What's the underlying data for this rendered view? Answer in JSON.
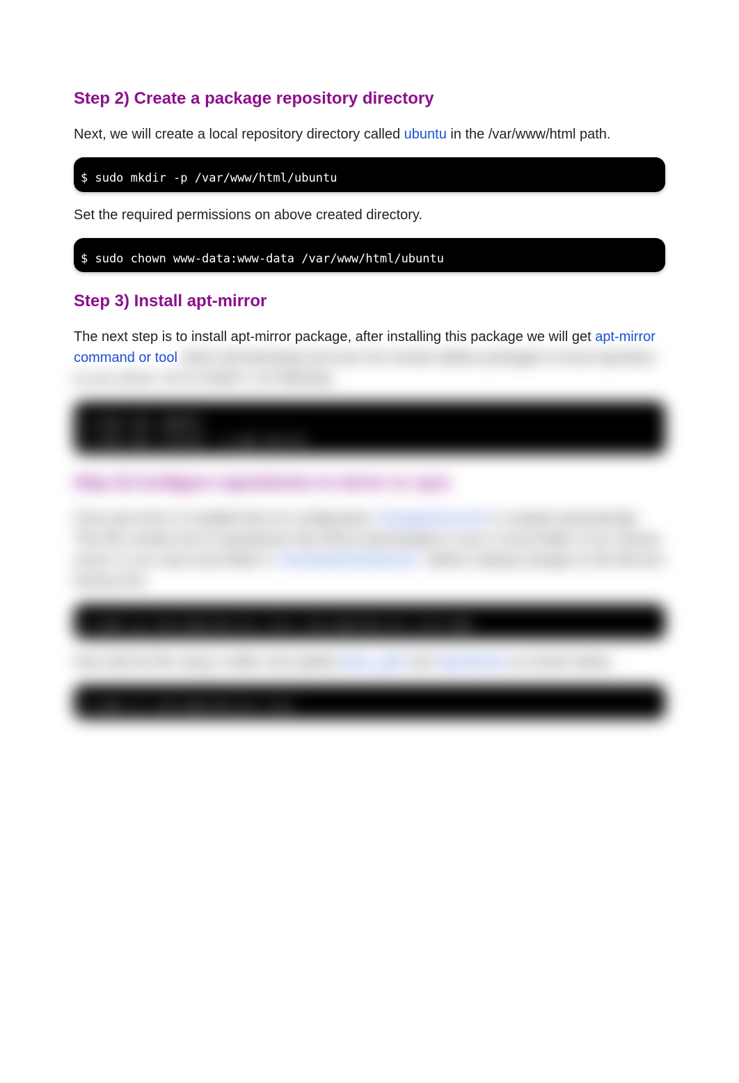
{
  "step2": {
    "heading": "Step 2) Create a package repository directory",
    "para1_prefix": "Next, we will create a local repository directory called ",
    "para1_highlight": "ubuntu",
    "para1_suffix": " in the /var/www/html path.",
    "code1": "$ sudo mkdir -p /var/www/html/ubuntu",
    "para2": "Set the required permissions on above created directory.",
    "code2": "$ sudo chown www-data:www-data /var/www/html/ubuntu"
  },
  "step3": {
    "heading": "Step 3) Install apt-mirror",
    "para1_prefix": "The next step is to install apt-mirror package, after installing this package we will get ",
    "para1_highlight": "apt-mirror command or tool",
    "blurred_para1_rest": " which will download and sync the remote debian packages to local repository on our server. So to install it, run following",
    "blurred_code1": "$ sudo apt update\n$ sudo apt install -y apt-mirror"
  },
  "step4": {
    "heading": "Step 4) Configure repositories to mirror or sync",
    "para1_a": "Once apt-mirror is installed then its configuration ",
    "para1_hl1": "'/etc/apt/mirror.list'",
    "para1_b": " is created automatically. This file contains list of repositories that will be downloaded or sync in local folder of our Ubuntu server. In our case local folder is ",
    "para1_hl2": "'/var/www/html/ubuntu/'",
    "para1_c": ". Before making changes to this file let's backup first.",
    "code1": "$ sudo cp /etc/apt/mirror.list /etc/apt/mirror.list-bak",
    "para2_a": "Now edit the file using vi editor and update ",
    "para2_hl1": "base_path",
    "para2_b": " and ",
    "para2_hl2": "repositories",
    "para2_c": " as shown below.",
    "code2": "$ sudo vi /etc/apt/mirror.list"
  }
}
